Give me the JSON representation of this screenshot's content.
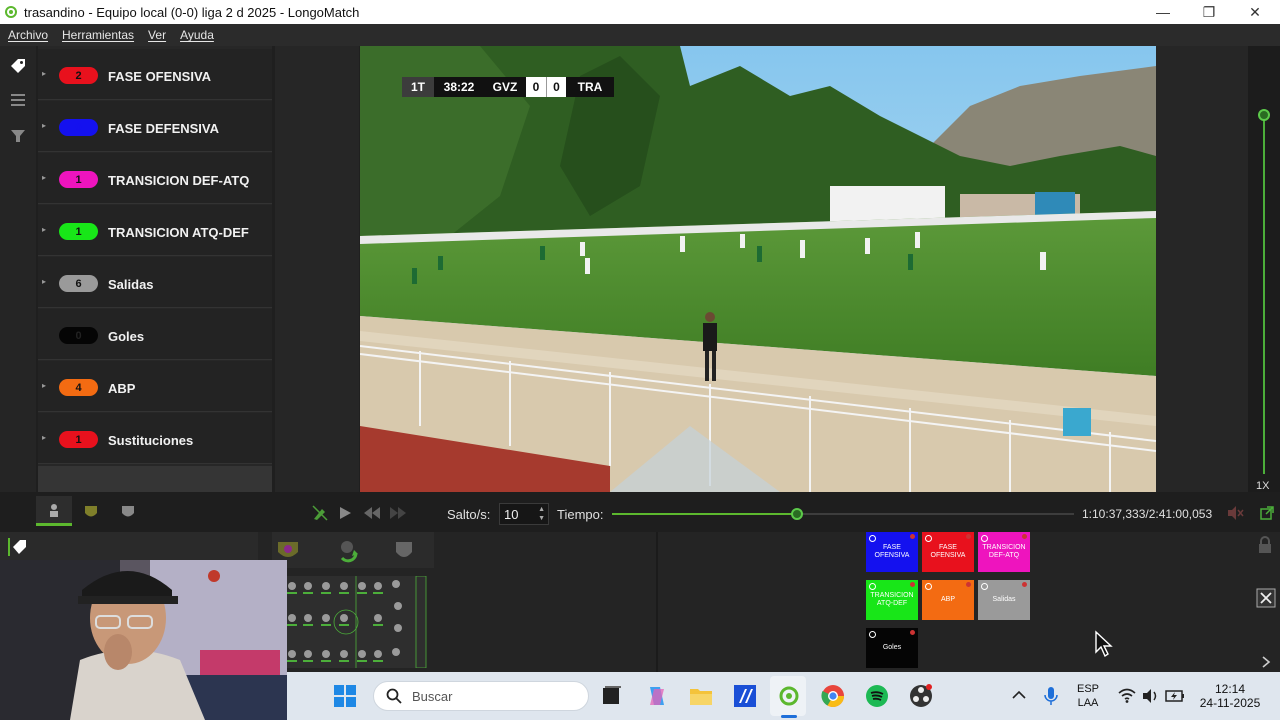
{
  "window": {
    "title": "trasandino - Equipo local (0-0) liga 2 d 2025 - LongoMatch",
    "minimize": "—",
    "maximize": "❐",
    "close": "✕"
  },
  "menu": {
    "items": [
      "Archivo",
      "Herramientas",
      "Ver",
      "Ayuda"
    ]
  },
  "categories": [
    {
      "count": "2",
      "label": "FASE OFENSIVA",
      "color": "#e8111d",
      "arrow": "▸"
    },
    {
      "count": "0",
      "label": "FASE DEFENSIVA",
      "color": "#1411ef",
      "arrow": "▸"
    },
    {
      "count": "1",
      "label": "TRANSICION DEF-ATQ",
      "color": "#ee14be",
      "arrow": "▸"
    },
    {
      "count": "1",
      "label": "TRANSICION ATQ-DEF",
      "color": "#18e618",
      "arrow": "▸"
    },
    {
      "count": "6",
      "label": "Salidas",
      "color": "#9a9a9a",
      "arrow": "▸"
    },
    {
      "count": "0",
      "label": "Goles",
      "color": "#050505",
      "arrow": ""
    },
    {
      "count": "4",
      "label": "ABP",
      "color": "#f36b12",
      "arrow": "▸"
    },
    {
      "count": "1",
      "label": "Sustituciones",
      "color": "#e8111d",
      "arrow": "▸"
    }
  ],
  "scoreboard": {
    "period": "1T",
    "clock": "38:22",
    "home": "GVZ",
    "home_score": "0",
    "away_score": "0",
    "away": "TRA"
  },
  "playback": {
    "jump_label": "Salto/s:",
    "jump_value": "10",
    "time_label": "Tiempo:",
    "position": 0.4,
    "time_readout": "1:10:37,333/2:41:00,053",
    "speed": "1X"
  },
  "tag_buttons": [
    {
      "label": "FASE OFENSIVA",
      "color": "#1411ef"
    },
    {
      "label": "FASE OFENSIVA",
      "color": "#e8111d"
    },
    {
      "label": "TRANSICION DEF-ATQ",
      "color": "#ee14be"
    },
    {
      "label": "TRANSICION ATQ-DEF",
      "color": "#18e618"
    },
    {
      "label": "ABP",
      "color": "#f36b12"
    },
    {
      "label": "Salidas",
      "color": "#9a9a9a"
    },
    {
      "label": "Goles",
      "color": "#050505"
    }
  ],
  "taskbar": {
    "search_placeholder": "Buscar",
    "lang_top": "ESP",
    "lang_bottom": "LAA",
    "time": "12:14",
    "date": "24-11-2025"
  }
}
